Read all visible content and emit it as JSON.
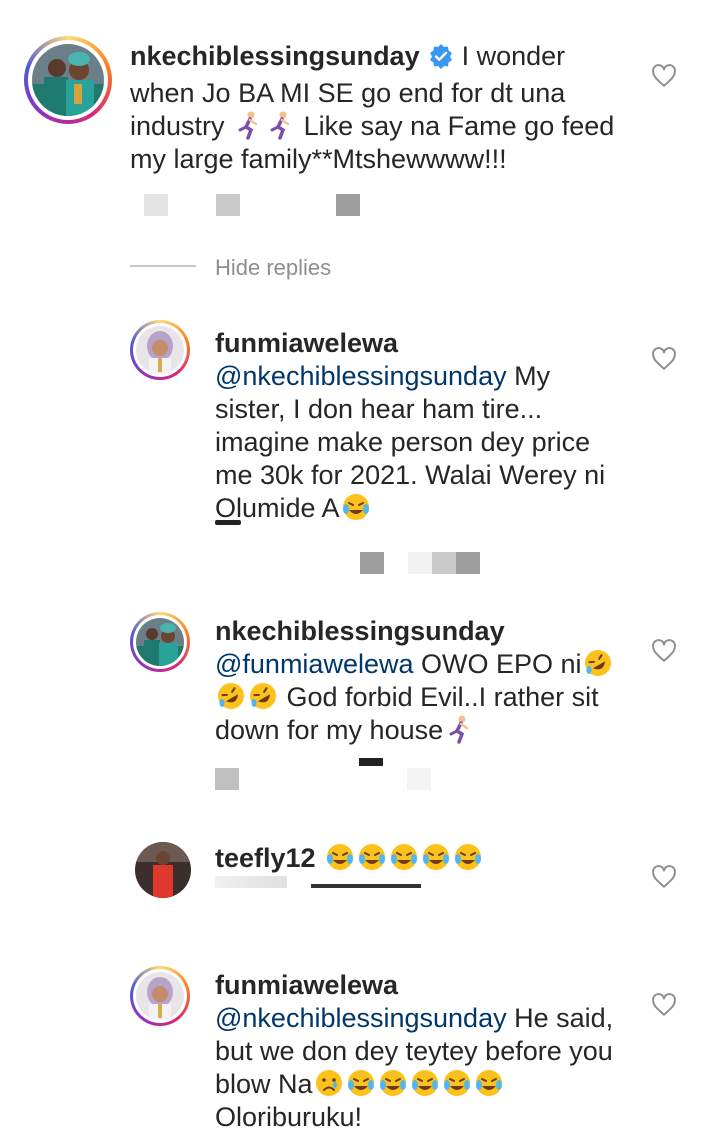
{
  "thread": {
    "parent": {
      "username": "nkechiblessingsunday",
      "verified": true,
      "text": "I wonder when Jo BA MI SE go end for dt una industry",
      "text2": "Like say na Fame go feed my large family**Mtshewwww!!!"
    },
    "hide_replies_label": "Hide replies",
    "replies": [
      {
        "username": "funmiawelewa",
        "mention": "@nkechiblessingsunday",
        "text": "My sister, I don hear ham tire... imagine make person dey price me 30k for 2021. Walai Werey ni Olumide A"
      },
      {
        "username": "nkechiblessingsunday",
        "mention": "@funmiawelewa",
        "text": "OWO EPO ni",
        "text2": "God forbid Evil..I rather sit down for my house"
      },
      {
        "username": "teefly12",
        "mention": "",
        "text": ""
      },
      {
        "username": "funmiawelewa",
        "mention": "@nkechiblessingsunday",
        "text": "He said, but we don dey teytey before you blow Na",
        "text2": "Oloriburuku!"
      }
    ]
  },
  "colors": {
    "text": "#262626",
    "mention": "#00376b",
    "muted": "#8e8e8e",
    "verified": "#3897f0",
    "green_outfit": "#1e7a6f",
    "red_outfit": "#e0392b"
  },
  "icons": {
    "like": "heart-outline-icon",
    "verified": "verified-badge-icon",
    "runner": "woman-running-emoji",
    "joy": "face-with-tears-of-joy-emoji",
    "rofl": "rolling-on-floor-laughing-emoji",
    "sad": "crying-face-emoji"
  }
}
